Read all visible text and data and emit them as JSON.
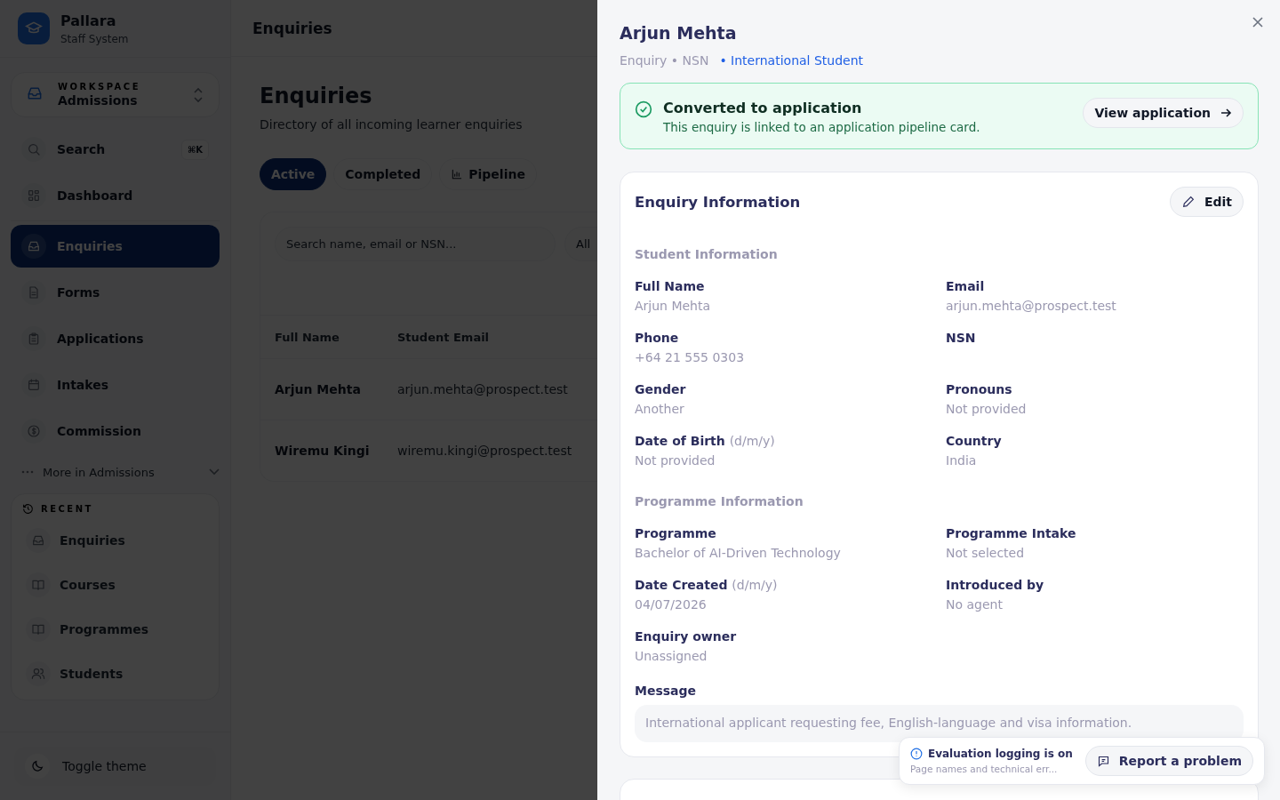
{
  "brand": {
    "name": "Pallara",
    "subtitle": "Staff System"
  },
  "workspace": {
    "label": "WORKSPACE",
    "name": "Admissions"
  },
  "nav": [
    {
      "label": "Search",
      "selected": false,
      "shortcut": "⌘K"
    },
    {
      "label": "Dashboard",
      "selected": false
    },
    {
      "label": "Enquiries",
      "selected": true
    },
    {
      "label": "Forms",
      "selected": false
    },
    {
      "label": "Applications",
      "selected": false
    },
    {
      "label": "Intakes",
      "selected": false
    },
    {
      "label": "Commission",
      "selected": false
    }
  ],
  "more": {
    "label": "More in Admissions",
    "expanded": false
  },
  "recent": {
    "title": "RECENT",
    "items": [
      {
        "label": "Enquiries"
      },
      {
        "label": "Courses"
      },
      {
        "label": "Programmes"
      },
      {
        "label": "Students"
      }
    ]
  },
  "toggle_theme": "Toggle theme",
  "header": {
    "title": "Enquiries"
  },
  "page": {
    "title": "Enquiries",
    "subtitle": "Directory of all incoming learner enquiries",
    "tabs": [
      {
        "label": "Active",
        "selected": true
      },
      {
        "label": "Completed",
        "selected": false
      },
      {
        "label": "Pipeline",
        "selected": false
      }
    ],
    "search": {
      "placeholder": "Search name, email or NSN..."
    },
    "filter": "All",
    "table": {
      "columns": [
        "Full Name",
        "Student Email"
      ],
      "rows": [
        [
          "Arjun Mehta",
          "arjun.mehta@prospect.test"
        ],
        [
          "Wiremu Kingi",
          "wiremu.kingi@prospect.test"
        ]
      ]
    }
  },
  "drawer": {
    "title": "Arjun Mehta",
    "meta": "Enquiry • NSN",
    "tag": "• International Student",
    "banner": {
      "title": "Converted to application",
      "text": "This enquiry is linked to an application pipeline card.",
      "button": "View application"
    },
    "card": {
      "title": "Enquiry Information",
      "edit": "Edit",
      "sections": [
        {
          "title": "Student Information",
          "fields": [
            {
              "label": "Full Name",
              "value": "Arjun Mehta"
            },
            {
              "label": "Email",
              "value": "arjun.mehta@prospect.test"
            },
            {
              "label": "Phone",
              "value": "+64 21 555 0303"
            },
            {
              "label": "NSN"
            },
            {
              "label": "Gender",
              "value": "Another"
            },
            {
              "label": "Pronouns",
              "value": "Not provided"
            },
            {
              "label": "Date of Birth",
              "hint": "(d/m/y)",
              "value": "Not provided"
            },
            {
              "label": "Country",
              "value": "India"
            }
          ]
        },
        {
          "title": "Programme Information",
          "fields": [
            {
              "label": "Programme",
              "value": "Bachelor of AI-Driven Technology"
            },
            {
              "label": "Programme Intake",
              "value": "Not selected"
            },
            {
              "label": "Date Created",
              "hint": "(d/m/y)",
              "value": "04/07/2026"
            },
            {
              "label": "Introduced by",
              "value": "No agent"
            },
            {
              "label": "Enquiry owner",
              "value": "Unassigned"
            }
          ]
        }
      ],
      "message": {
        "label": "Message",
        "value": "International applicant requesting fee, English-language and visa information."
      }
    }
  },
  "toast": {
    "title": "Evaluation logging is on",
    "text": "Page names and technical err...",
    "button": "Report a problem"
  }
}
